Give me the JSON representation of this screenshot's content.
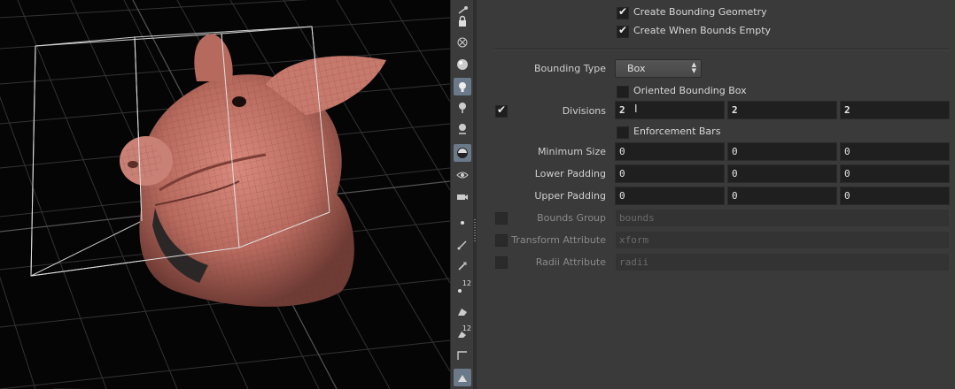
{
  "params": {
    "create_bounding_geometry": {
      "label": "Create Bounding Geometry",
      "checked": true
    },
    "create_when_bounds_empty": {
      "label": "Create When Bounds Empty",
      "checked": true
    },
    "bounding_type": {
      "label": "Bounding Type",
      "value": "Box"
    },
    "oriented_bounding_box": {
      "label": "Oriented Bounding Box",
      "checked": false
    },
    "divisions": {
      "label": "Divisions",
      "enabled": true,
      "values": [
        "2",
        "2",
        "2"
      ]
    },
    "enforcement_bars": {
      "label": "Enforcement Bars",
      "checked": false
    },
    "minimum_size": {
      "label": "Minimum Size",
      "values": [
        "0",
        "0",
        "0"
      ]
    },
    "lower_padding": {
      "label": "Lower Padding",
      "values": [
        "0",
        "0",
        "0"
      ]
    },
    "upper_padding": {
      "label": "Upper Padding",
      "values": [
        "0",
        "0",
        "0"
      ]
    },
    "bounds_group": {
      "label": "Bounds Group",
      "enabled": false,
      "value": "bounds"
    },
    "transform_attribute": {
      "label": "Transform Attribute",
      "enabled": false,
      "value": "xform"
    },
    "radii_attribute": {
      "label": "Radii Attribute",
      "enabled": false,
      "value": "radii"
    }
  },
  "toolbar": {
    "icons": [
      "view-handle-icon",
      "lock-icon",
      "snap-off-icon",
      "shaded-sphere-icon",
      "light-icon",
      "light-pin-icon",
      "light-link-icon",
      "texture-icon",
      "eye-icon",
      "camera-icon",
      "point-icon",
      "normal-icon",
      "vector-icon",
      "point-number-icon",
      "prim-icon",
      "prim-number-icon",
      "grid-icon",
      "background-icon"
    ],
    "point_number_badge": "12",
    "prim_number_badge": "12"
  },
  "viewport": {
    "background": "#000000",
    "grid_color": "#2f2f2f",
    "box_color": "#d8d8d8",
    "model_color": "#c7796c"
  }
}
